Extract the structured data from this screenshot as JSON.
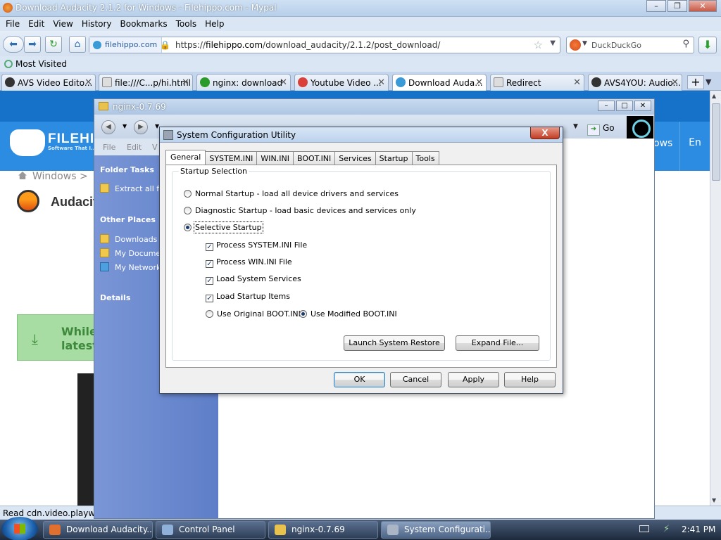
{
  "firefox": {
    "title": "Download Audacity 2.1.2 for Windows - Filehippo.com - Mypal",
    "menu": [
      "File",
      "Edit",
      "View",
      "History",
      "Bookmarks",
      "Tools",
      "Help"
    ],
    "site_identity": "filehippo.com",
    "url_prefix": "https://",
    "url_host": "filehippo.com",
    "url_path": "/download_audacity/2.1.2/post_download/",
    "search_placeholder": "DuckDuckGo",
    "bookmarks_toolbar": "Most Visited",
    "tabs": [
      {
        "label": "AVS Video Edito...",
        "icon_color": "#333333"
      },
      {
        "label": "file:///C...p/hi.html",
        "icon_color": "#dddddd"
      },
      {
        "label": "nginx: download",
        "icon_color": "#2a9a2a"
      },
      {
        "label": "Youtube Video ...",
        "icon_color": "#d9403a"
      },
      {
        "label": "Download Auda...",
        "icon_color": "#3a9ad6",
        "active": true
      },
      {
        "label": "Redirect",
        "icon_color": "#dddddd"
      },
      {
        "label": "AVS4YOU: Audio...",
        "icon_color": "#333333"
      }
    ],
    "status": "Read cdn.video.playwire..."
  },
  "page": {
    "brand": "FILEHIPPO",
    "tagline": "Software That I...",
    "nav_partial": "ows",
    "language": "En",
    "breadcrumb": "Windows  >",
    "app_title": "Audacity",
    "download_notice_1": "While",
    "download_notice_2": "latest"
  },
  "explorer": {
    "title": "nginx-0.7.69",
    "menu": [
      "File",
      "Edit",
      "V"
    ],
    "go_label": "Go",
    "folder_tasks": "Folder Tasks",
    "extract_all": "Extract all fil",
    "other_places": "Other Places",
    "places": [
      "Downloads",
      "My Documer",
      "My Network"
    ],
    "details": "Details"
  },
  "dialog": {
    "title": "System Configuration Utility",
    "close": "X",
    "tabs": [
      "General",
      "SYSTEM.INI",
      "WIN.INI",
      "BOOT.INI",
      "Services",
      "Startup",
      "Tools"
    ],
    "group_label": "Startup Selection",
    "normal": "Normal Startup - load all device drivers and services",
    "diagnostic": "Diagnostic Startup - load basic devices and services only",
    "selective": "Selective Startup",
    "opt_system_ini": "Process SYSTEM.INI File",
    "opt_win_ini": "Process WIN.INI File",
    "opt_services": "Load System Services",
    "opt_startup": "Load Startup Items",
    "boot_original": "Use Original BOOT.INI",
    "boot_modified": "Use Modified BOOT.INI",
    "launch_restore": "Launch System Restore",
    "expand_file": "Expand File...",
    "ok": "OK",
    "cancel": "Cancel",
    "apply": "Apply",
    "help": "Help"
  },
  "taskbar": {
    "items": [
      {
        "label": "Download Audacity...",
        "icon_color": "#e07030"
      },
      {
        "label": "Control Panel",
        "icon_color": "#8fb0d8"
      },
      {
        "label": "nginx-0.7.69",
        "icon_color": "#e8c24c"
      },
      {
        "label": "System Configurati...",
        "icon_color": "#aab6c6",
        "active": true
      }
    ],
    "clock": "2:41 PM"
  }
}
